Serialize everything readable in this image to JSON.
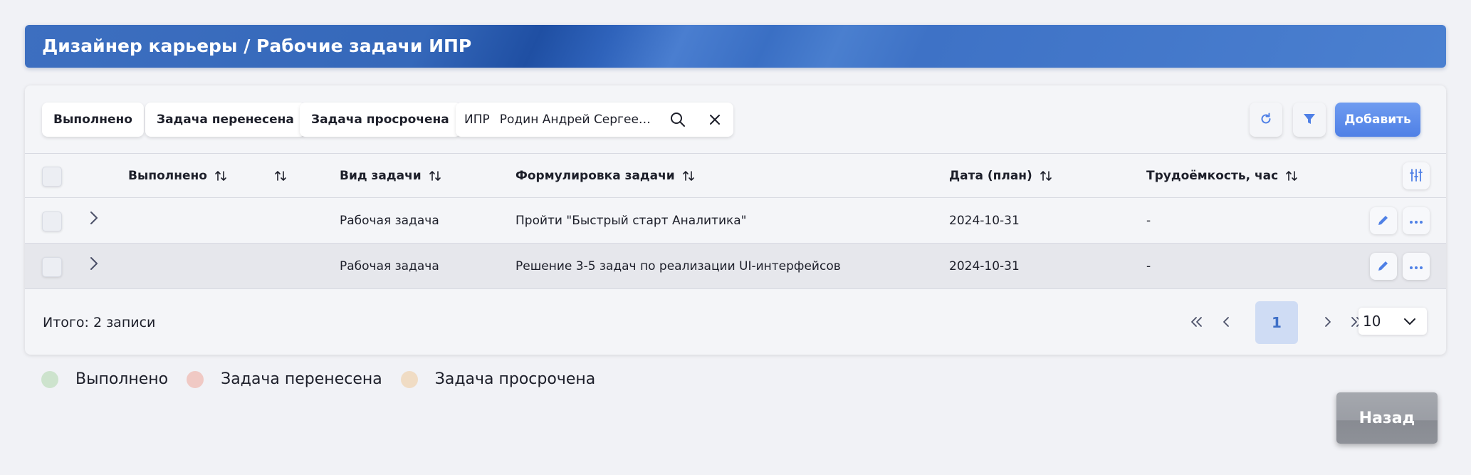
{
  "header": {
    "title": "Дизайнер карьеры / Рабочие задачи ИПР"
  },
  "toolbar": {
    "chips": [
      "Выполнено",
      "Задача перенесена",
      "Задача просрочена"
    ],
    "search": {
      "prefix": "ИПР",
      "value": "Родин Андрей Сергеевич"
    },
    "add_label": "Добавить"
  },
  "table": {
    "columns": {
      "done": "Выполнено",
      "type": "Вид задачи",
      "wording": "Формулировка задачи",
      "date": "Дата (план)",
      "effort": "Трудоёмкость, час"
    },
    "rows": [
      {
        "type": "Рабочая задача",
        "wording": "Пройти \"Быстрый старт Аналитика\"",
        "date": "2024-10-31",
        "effort": "-"
      },
      {
        "type": "Рабочая задача",
        "wording": "Решение 3-5 задач по реализации UI-интерфейсов",
        "date": "2024-10-31",
        "effort": "-"
      }
    ]
  },
  "footer": {
    "total": "Итого: 2 записи",
    "current_page": "1",
    "per_page": "10"
  },
  "legend": [
    {
      "label": "Выполнено",
      "color": "#cde3cd"
    },
    {
      "label": "Задача перенесена",
      "color": "#f0c9c4"
    },
    {
      "label": "Задача просрочена",
      "color": "#f0dcc4"
    }
  ],
  "back_label": "Назад",
  "colors": {
    "accent": "#4f80e6",
    "header": "#3d6fc0"
  },
  "icons": {
    "refresh": "refresh-icon",
    "filter": "filter-icon",
    "search": "search-icon",
    "clear": "close-icon",
    "columns": "sliders-icon",
    "edit": "pencil-icon",
    "more": "more-dots-icon",
    "expand": "chevron-right-icon"
  }
}
